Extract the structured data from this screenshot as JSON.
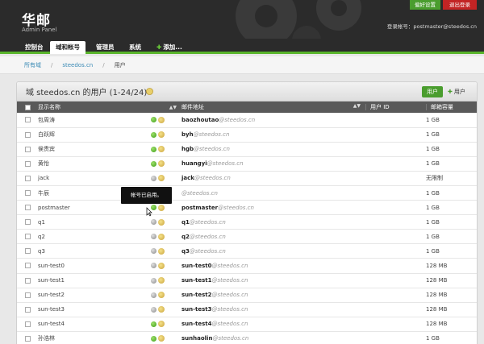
{
  "header": {
    "title": "华邮",
    "subtitle": "Admin Panel",
    "pref_button": "偏好设置",
    "logout_button": "退出登录",
    "login_account": "登录帐号：postmaster@steedos.cn"
  },
  "nav": {
    "items": [
      "控制台",
      "域和帐号",
      "管理员",
      "系统",
      "添加..."
    ],
    "active": "域和帐号"
  },
  "breadcrumb": [
    "所有域",
    "steedos.cn",
    "用户"
  ],
  "panel": {
    "title": "域 steedos.cn 的用户 (1-24/24)",
    "users_button": "用户",
    "add_user_button": "用户"
  },
  "table": {
    "headers": {
      "name": "显示名称",
      "mail": "邮件地址",
      "uid": "用户 ID",
      "quota": "邮箱容量"
    },
    "domain": "@steedos.cn",
    "rows": [
      {
        "name": "包周涛",
        "user": "baozhoutao",
        "uid": "",
        "quota": "1 GB",
        "enabled": true
      },
      {
        "name": "白跃辉",
        "user": "byh",
        "uid": "",
        "quota": "1 GB",
        "enabled": true
      },
      {
        "name": "侯贵宾",
        "user": "hgb",
        "uid": "",
        "quota": "1 GB",
        "enabled": true
      },
      {
        "name": "黄怡",
        "user": "huangyi",
        "uid": "",
        "quota": "1 GB",
        "enabled": true
      },
      {
        "name": "jack",
        "user": "jack",
        "uid": "",
        "quota": "无限制",
        "enabled": false
      },
      {
        "name": "牛辰",
        "user": "",
        "uid": "",
        "quota": "1 GB",
        "enabled": false
      },
      {
        "name": "postmaster",
        "user": "postmaster",
        "uid": "",
        "quota": "1 GB",
        "enabled": true
      },
      {
        "name": "q1",
        "user": "q1",
        "uid": "",
        "quota": "1 GB",
        "enabled": false
      },
      {
        "name": "q2",
        "user": "q2",
        "uid": "",
        "quota": "1 GB",
        "enabled": false
      },
      {
        "name": "q3",
        "user": "q3",
        "uid": "",
        "quota": "1 GB",
        "enabled": false
      },
      {
        "name": "sun-test0",
        "user": "sun-test0",
        "uid": "",
        "quota": "128 MB",
        "enabled": false
      },
      {
        "name": "sun-test1",
        "user": "sun-test1",
        "uid": "",
        "quota": "128 MB",
        "enabled": false
      },
      {
        "name": "sun-test2",
        "user": "sun-test2",
        "uid": "",
        "quota": "128 MB",
        "enabled": false
      },
      {
        "name": "sun-test3",
        "user": "sun-test3",
        "uid": "",
        "quota": "128 MB",
        "enabled": false
      },
      {
        "name": "sun-test4",
        "user": "sun-test4",
        "uid": "",
        "quota": "128 MB",
        "enabled": true
      },
      {
        "name": "孙浩林",
        "user": "sunhaolin",
        "uid": "",
        "quota": "1 GB",
        "enabled": true
      }
    ]
  },
  "tooltip": "帐号已启用。",
  "colors": {
    "accent_green": "#4a9d2e",
    "logout_red": "#c22424",
    "header_bg": "#2b2b2b"
  },
  "icons": [
    "status-dot-icon",
    "key-icon",
    "sort-icon",
    "plus-icon",
    "gears-icon",
    "cursor-icon"
  ]
}
